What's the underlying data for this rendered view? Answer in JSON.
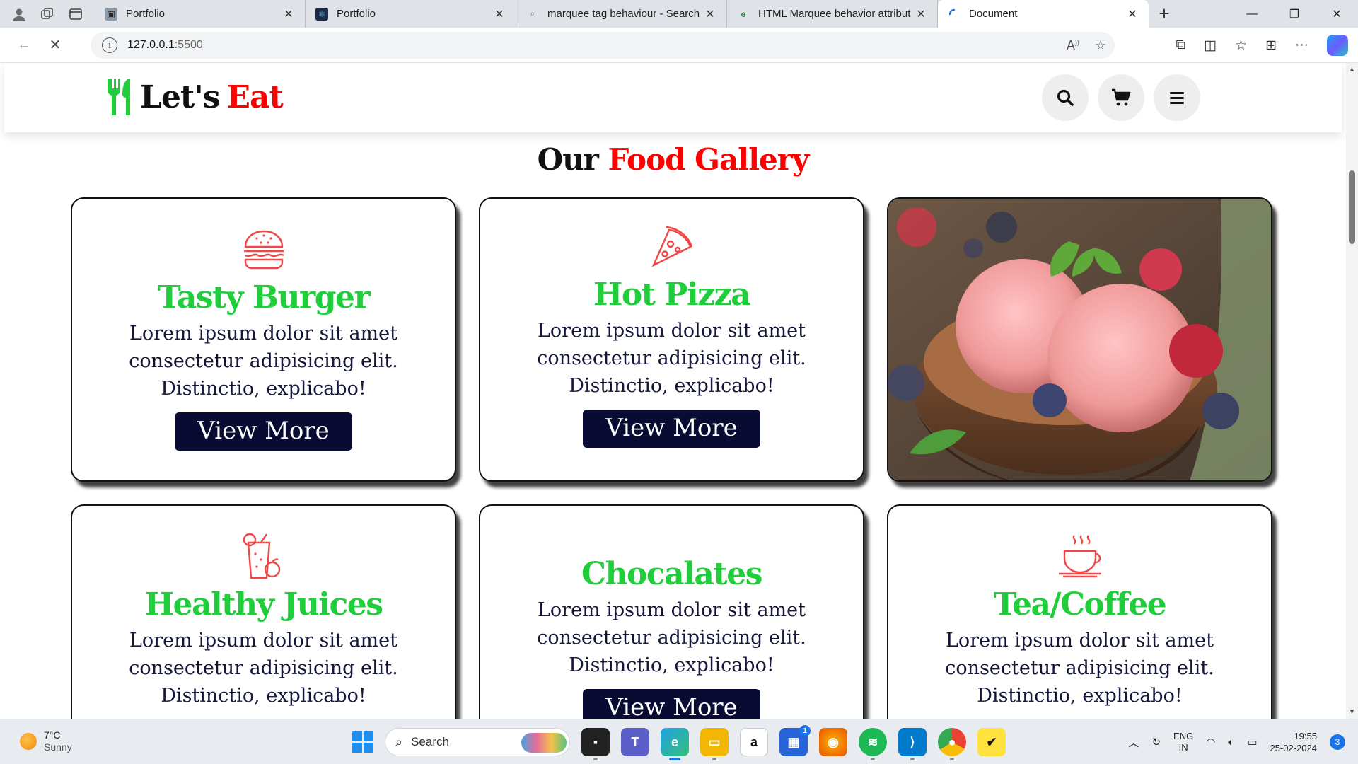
{
  "browser": {
    "tabs": [
      {
        "title": "Portfolio",
        "favicon": "portfolio-favicon",
        "active": false
      },
      {
        "title": "Portfolio",
        "favicon": "react-favicon",
        "active": false
      },
      {
        "title": "marquee tag behaviour - Search",
        "favicon": "search-favicon",
        "active": false
      },
      {
        "title": "HTML Marquee behavior attribut",
        "favicon": "gfg-favicon",
        "active": false
      },
      {
        "title": "Document",
        "favicon": "loading-favicon",
        "active": true
      }
    ],
    "address": {
      "host": "127.0.0.1",
      "port": ":5500"
    }
  },
  "site": {
    "logo": {
      "word1": "Let's",
      "word2": "Eat"
    },
    "header_buttons": [
      "search-icon",
      "cart-icon",
      "menu-icon"
    ],
    "gallery_title": {
      "part1": "Our",
      "part2": "Food Gallery"
    },
    "colors": {
      "accent_red": "#ff0000",
      "accent_green": "#1fce3a",
      "button_navy": "#090b33"
    },
    "cards": [
      {
        "icon": "burger-icon",
        "title": "Tasty Burger",
        "lines": [
          "Lorem ipsum dolor sit amet",
          "consectetur adipisicing elit.",
          "Distinctio, explicabo!"
        ],
        "button": "View More"
      },
      {
        "icon": "pizza-icon",
        "title": "Hot Pizza",
        "lines": [
          "Lorem ipsum dolor sit amet",
          "consectetur adipisicing elit.",
          "Distinctio, explicabo!"
        ],
        "button": "View More"
      },
      {
        "icon": "juice-icon",
        "title": "Healthy Juices",
        "lines": [
          "Lorem ipsum dolor sit amet",
          "consectetur adipisicing elit.",
          "Distinctio, explicabo!"
        ]
      },
      {
        "icon": "",
        "title": "Chocalates",
        "lines": [
          "Lorem ipsum dolor sit amet",
          "consectetur adipisicing elit.",
          "Distinctio, explicabo!"
        ],
        "button": "View More"
      },
      {
        "icon": "coffee-icon",
        "title": "Tea/Coffee",
        "lines": [
          "Lorem ipsum dolor sit amet",
          "consectetur adipisicing elit.",
          "Distinctio, explicabo!"
        ]
      }
    ]
  },
  "taskbar": {
    "weather": {
      "temp": "7°C",
      "condition": "Sunny"
    },
    "search_placeholder": "Search",
    "lang": {
      "line1": "ENG",
      "line2": "IN"
    },
    "time": "19:55",
    "date": "25-02-2024",
    "notifications": "3",
    "store_badge": "1"
  }
}
